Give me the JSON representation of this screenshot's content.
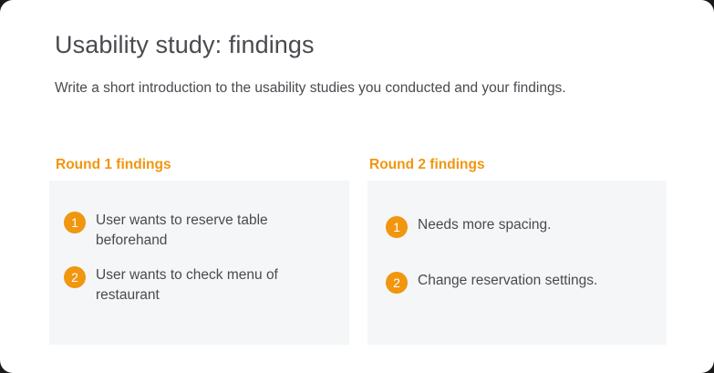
{
  "slide": {
    "title": "Usability study: findings",
    "intro": "Write a short introduction to the usability studies you conducted and your findings."
  },
  "rounds": [
    {
      "heading": "Round 1 findings",
      "findings": [
        {
          "number": "1",
          "text": "User wants to reserve table beforehand"
        },
        {
          "number": "2",
          "text": "User wants to check menu of restaurant"
        }
      ]
    },
    {
      "heading": "Round 2 findings",
      "findings": [
        {
          "number": "1",
          "text": "Needs more spacing."
        },
        {
          "number": "2",
          "text": "Change reservation settings."
        }
      ]
    }
  ],
  "colors": {
    "accent": "#f0960f",
    "panel_background": "#f5f6f8",
    "text": "#4a4a50"
  }
}
